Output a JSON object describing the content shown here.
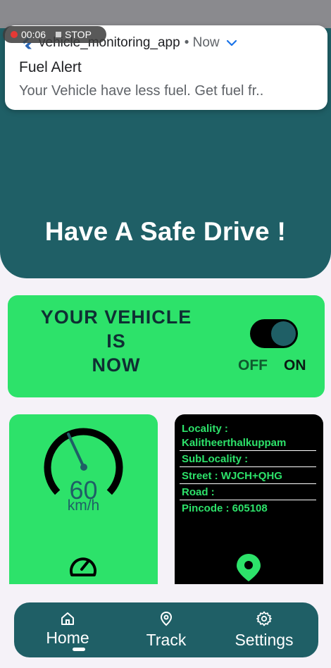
{
  "notification": {
    "app_name": "vehicle_monitoring_app",
    "time": "• Now",
    "title": "Fuel Alert",
    "body": "Your Vehicle have less fuel. Get fuel fr.."
  },
  "recording": {
    "elapsed": "00:06",
    "stop_label": "STOP"
  },
  "header": {
    "title": "Have A Safe Drive !"
  },
  "vehicle_status": {
    "line1": "YOUR VEHICLE",
    "line2": "IS",
    "line3": "NOW",
    "off_label": "OFF",
    "on_label": "ON",
    "is_on": true
  },
  "speed": {
    "value": "60",
    "unit": "km/h",
    "icon": "speedometer-icon"
  },
  "location": {
    "rows": [
      {
        "text": "Locality :"
      },
      {
        "text": "Kalitheerthalkuppam"
      },
      {
        "text": "SubLocality :"
      },
      {
        "text": "Street : WJCH+QHG"
      },
      {
        "text": "Road :"
      },
      {
        "text": "Pincode : 605108"
      }
    ],
    "icon": "location-pin-icon"
  },
  "nav": {
    "items": [
      {
        "label": "Home",
        "icon": "home-icon",
        "active": true
      },
      {
        "label": "Track",
        "icon": "location-pin-icon"
      },
      {
        "label": "Settings",
        "icon": "gear-icon"
      }
    ]
  },
  "colors": {
    "primary": "#1f5f66",
    "accent_green": "#2de26a",
    "background": "#f5f2f8"
  }
}
